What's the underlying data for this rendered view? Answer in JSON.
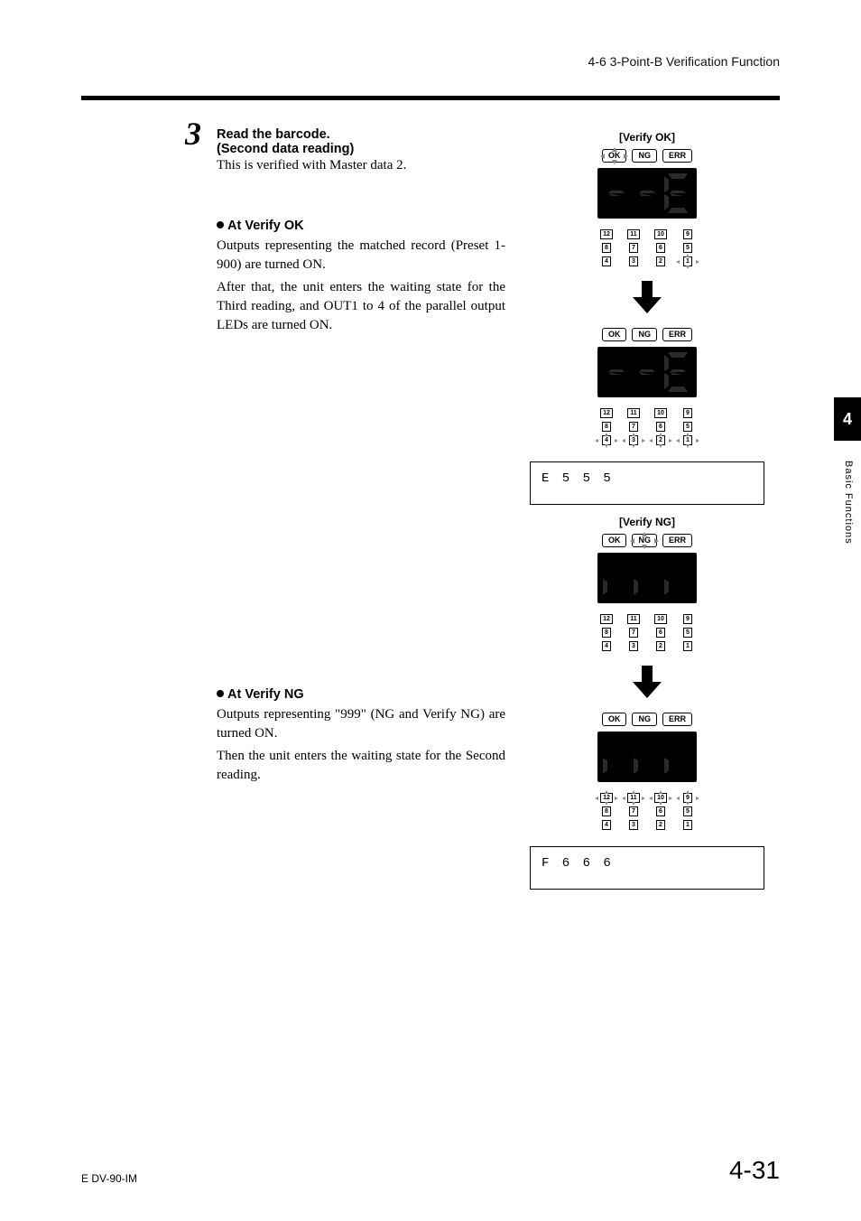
{
  "header": {
    "section": "4-6  3-Point-B Verification Function"
  },
  "step": {
    "number": "3",
    "title": "Read the barcode.",
    "subtitle": "(Second data reading)",
    "desc": "This is verified with Master data 2."
  },
  "verify_ok": {
    "heading": "At Verify OK",
    "body1": "Outputs representing the matched record (Preset 1-900) are turned ON.",
    "body2": "After that, the unit enters the waiting state for the Third reading, and OUT1 to 4 of the parallel output LEDs are turned ON.",
    "caption": "[Verify OK]",
    "display_value": "001",
    "status": {
      "ok": "OK",
      "ng": "NG",
      "err": "ERR",
      "glow": "ok"
    },
    "leds_top_glow": [
      "1"
    ],
    "leds_bottom_glow": [
      "4",
      "3",
      "2",
      "1"
    ],
    "data_box": "E 5 5 5"
  },
  "verify_ng": {
    "heading": "At Verify NG",
    "body1": "Outputs representing \"999\" (NG and Verify NG) are turned ON.",
    "body2": "Then the unit enters the waiting state for the Second reading.",
    "caption": "[Verify NG]",
    "display_value": "999",
    "status": {
      "ok": "OK",
      "ng": "NG",
      "err": "ERR",
      "glow": "ng"
    },
    "leds_top_glow": [],
    "leds_bottom_glow": [
      "12",
      "11",
      "10",
      "9"
    ],
    "data_box": "F 6 6 6"
  },
  "led_numbers": [
    "12",
    "11",
    "10",
    "9",
    "8",
    "7",
    "6",
    "5",
    "4",
    "3",
    "2",
    "1"
  ],
  "side": {
    "chapter": "4",
    "label": "Basic Functions"
  },
  "footer": {
    "left": "E DV-90-IM",
    "right": "4-31"
  }
}
